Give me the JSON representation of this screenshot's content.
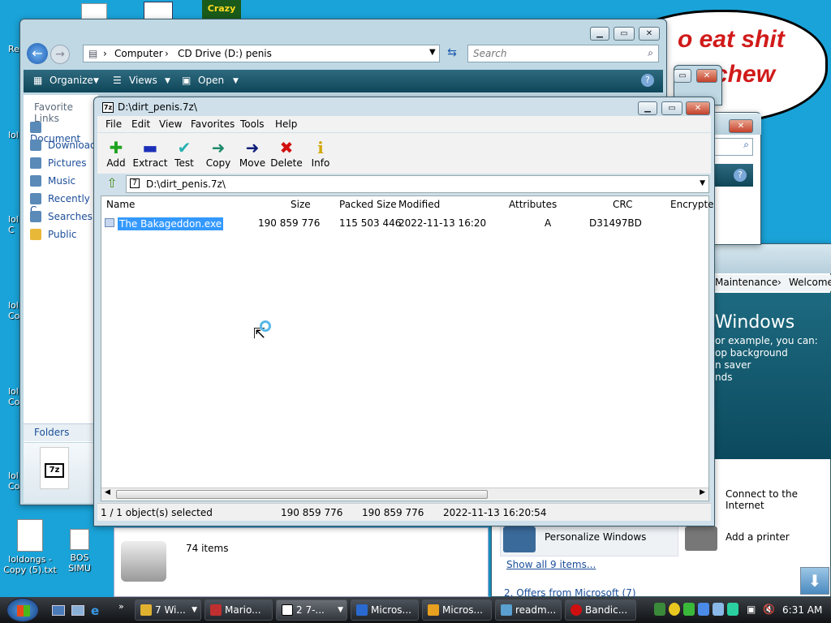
{
  "desktop": {
    "icons": [
      {
        "label": "loldongs - Copy (5).txt"
      },
      {
        "label": "BOS SIMU"
      }
    ],
    "edge_labels": [
      "Re",
      "lol",
      "lol C",
      "lol Co",
      "lol Co",
      "lol Co"
    ],
    "bubble_lines": [
      "o eat shit",
      "chew"
    ],
    "crazy_logo": "Crazy"
  },
  "explorer": {
    "breadcrumb": [
      "Computer",
      "CD Drive (D:) penis"
    ],
    "search_placeholder": "Search",
    "toolbar": {
      "organize": "Organize",
      "views": "Views",
      "open": "Open"
    },
    "favorite_links_title": "Favorite Links",
    "favorites": [
      "Document",
      "Download",
      "Pictures",
      "Music",
      "Recently C",
      "Searches",
      "Public"
    ],
    "folders_label": "Folders",
    "details_glyph": "7z"
  },
  "back_window": {
    "breadcrumb": [
      "Maintenance",
      "Welcome"
    ],
    "heading": "Windows",
    "lines": [
      "or example, you can:",
      "op background",
      "n saver",
      "nds"
    ],
    "items_count": "74 items",
    "personalize": "Personalize Windows",
    "add_printer": "Add a printer",
    "connect_internet": "Connect to the Internet",
    "show_all": "Show all 9 items...",
    "offers": "2. Offers from Microsoft (7)"
  },
  "sevenzip": {
    "title": "D:\\dirt_penis.7z\\",
    "menu": [
      "File",
      "Edit",
      "View",
      "Favorites",
      "Tools",
      "Help"
    ],
    "toolbar": [
      {
        "label": "Add",
        "glyph": "✚",
        "color": "#1fa31f"
      },
      {
        "label": "Extract",
        "glyph": "▬",
        "color": "#1c2fb8"
      },
      {
        "label": "Test",
        "glyph": "✔",
        "color": "#26b0b0"
      },
      {
        "label": "Copy",
        "glyph": "➜",
        "color": "#1e8a6a"
      },
      {
        "label": "Move",
        "glyph": "➜",
        "color": "#0e1e7a"
      },
      {
        "label": "Delete",
        "glyph": "✖",
        "color": "#d11010"
      },
      {
        "label": "Info",
        "glyph": "i",
        "color": "#d1a80a"
      }
    ],
    "path": "D:\\dirt_penis.7z\\",
    "columns": [
      "Name",
      "Size",
      "Packed Size",
      "Modified",
      "Attributes",
      "CRC",
      "Encrypte"
    ],
    "rows": [
      {
        "name": "The Bakageddon.exe",
        "size": "190 859 776",
        "packed": "115 503 446",
        "modified": "2022-11-13 16:20",
        "attributes": "A",
        "crc": "D31497BD"
      }
    ],
    "status": {
      "selected": "1 / 1 object(s) selected",
      "size": "190 859 776",
      "packed": "190 859 776",
      "modified": "2022-11-13 16:20:54"
    }
  },
  "taskbar": {
    "tasks": [
      {
        "label": "7 Wi...",
        "color": "#e0b030"
      },
      {
        "label": "Mario...",
        "color": "#c03030"
      },
      {
        "label": "2 7-...",
        "color": "#222222"
      },
      {
        "label": "Micros...",
        "color": "#2a6ad0"
      },
      {
        "label": "Micros...",
        "color": "#e8a020"
      },
      {
        "label": "readm...",
        "color": "#5aa0d0"
      },
      {
        "label": "Bandic...",
        "color": "#d01010"
      }
    ],
    "clock": "6:31 AM"
  }
}
